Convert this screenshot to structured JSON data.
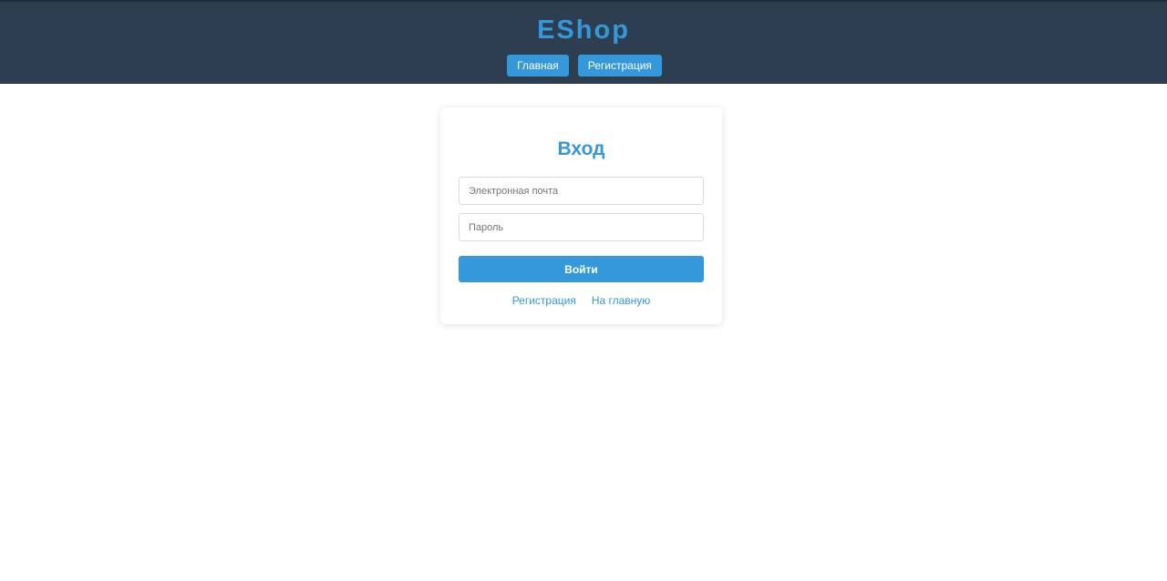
{
  "header": {
    "logo": "EShop",
    "nav": [
      {
        "label": "Главная"
      },
      {
        "label": "Регистрация"
      }
    ]
  },
  "login": {
    "title": "Вход",
    "email_placeholder": "Электронная почта",
    "email_value": "",
    "password_placeholder": "Пароль",
    "password_value": "",
    "submit_label": "Войти",
    "links": [
      {
        "label": "Регистрация"
      },
      {
        "label": "На главную"
      }
    ]
  },
  "colors": {
    "header_bg": "#2c3e50",
    "accent": "#3498db",
    "page_bg": "#ffffff"
  }
}
